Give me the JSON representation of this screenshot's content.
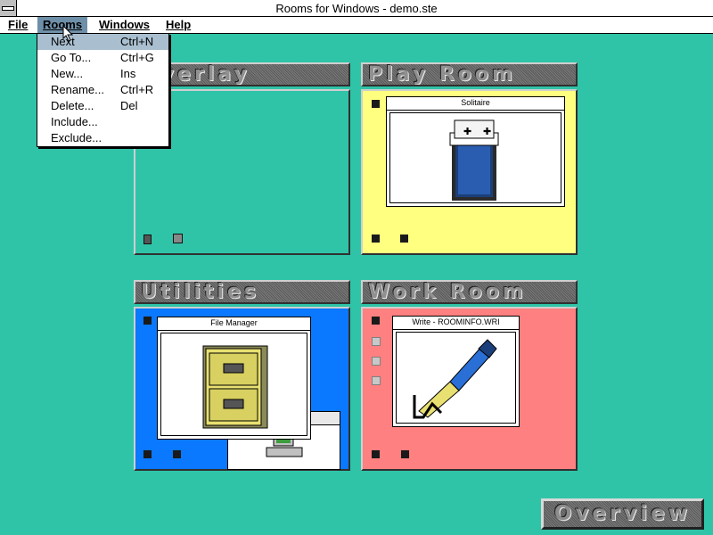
{
  "window": {
    "title": "Rooms for Windows - demo.ste"
  },
  "menubar": {
    "items": [
      {
        "label": "File"
      },
      {
        "label": "Rooms"
      },
      {
        "label": "Windows"
      },
      {
        "label": "Help"
      }
    ]
  },
  "rooms_menu": {
    "items": [
      {
        "label": "Next",
        "shortcut": "Ctrl+N"
      },
      {
        "label": "Go To...",
        "shortcut": "Ctrl+G"
      },
      {
        "label": "New...",
        "shortcut": "Ins"
      },
      {
        "label": "Rename...",
        "shortcut": "Ctrl+R"
      },
      {
        "label": "Delete...",
        "shortcut": "Del"
      },
      {
        "label": "Include...",
        "shortcut": ""
      },
      {
        "label": "Exclude...",
        "shortcut": ""
      }
    ]
  },
  "rooms": {
    "overlay": {
      "name": "Overlay",
      "color": "#2fc4a8"
    },
    "play": {
      "name": "Play Room",
      "color": "#ffff80",
      "window_title": "Solitaire"
    },
    "utilities": {
      "name": "Utilities",
      "color": "#0a78ff",
      "window_title": "File Manager"
    },
    "work": {
      "name": "Work Room",
      "color": "#ff8080",
      "window_title": "Write - ROOMINFO.WRI"
    }
  },
  "overview_button": {
    "label": "Overview"
  },
  "colors": {
    "desktop": "#2fc4a8",
    "menu_highlight": "#a9bfd0"
  }
}
